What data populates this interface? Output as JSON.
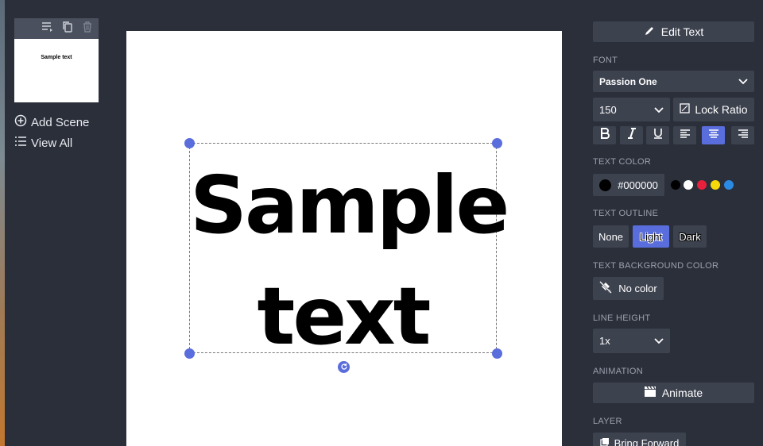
{
  "scenes": {
    "thumbnail_text": "Sample text",
    "add_scene": "Add Scene",
    "view_all": "View All"
  },
  "canvas": {
    "line1": "Sample",
    "line2": "text"
  },
  "panel": {
    "edit_text": "Edit Text",
    "font_label": "FONT",
    "font_name": "Passion One",
    "font_size": "150",
    "lock_ratio": "Lock Ratio",
    "text_color_label": "TEXT COLOR",
    "text_color_value": "#000000",
    "swatches": [
      "#000000",
      "#ffffff",
      "#e8203c",
      "#f5d90a",
      "#2b8ae2"
    ],
    "text_outline_label": "TEXT OUTLINE",
    "outline_options": [
      "None",
      "Light",
      "Dark"
    ],
    "outline_selected": "Light",
    "text_bg_label": "TEXT BACKGROUND COLOR",
    "no_color": "No color",
    "line_height_label": "LINE HEIGHT",
    "line_height_value": "1x",
    "animation_label": "ANIMATION",
    "animate": "Animate",
    "layer_label": "LAYER",
    "bring_forward": "Bring Forward"
  },
  "colors": {
    "accent": "#5a6ddc",
    "panel_bg": "#2b2f3a",
    "control_bg": "#3d424f"
  }
}
